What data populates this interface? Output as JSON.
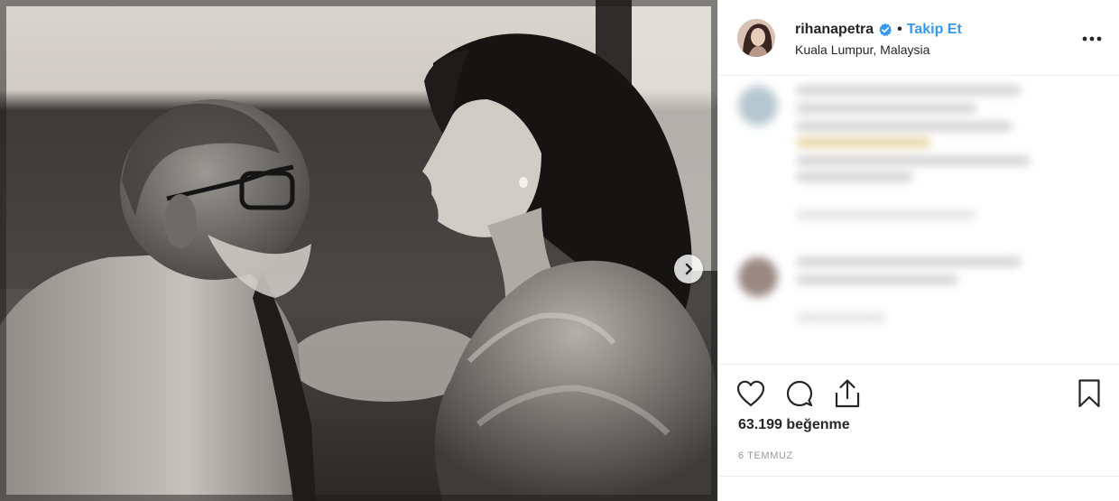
{
  "post": {
    "username": "rihanapetra",
    "separator": "•",
    "follow_label": "Takip Et",
    "location": "Kuala Lumpur, Malaysia",
    "likes_text": "63.199 beğenme",
    "date": "6 TEMMUZ"
  },
  "icons": {
    "verified": "verified-badge-icon",
    "more": "more-options-icon",
    "next": "chevron-right-icon",
    "like": "heart-icon",
    "comment": "comment-icon",
    "share": "share-icon",
    "save": "bookmark-icon"
  },
  "colors": {
    "accent": "#3897f0",
    "text": "#262626",
    "muted": "#999999",
    "divider": "#efefef"
  }
}
